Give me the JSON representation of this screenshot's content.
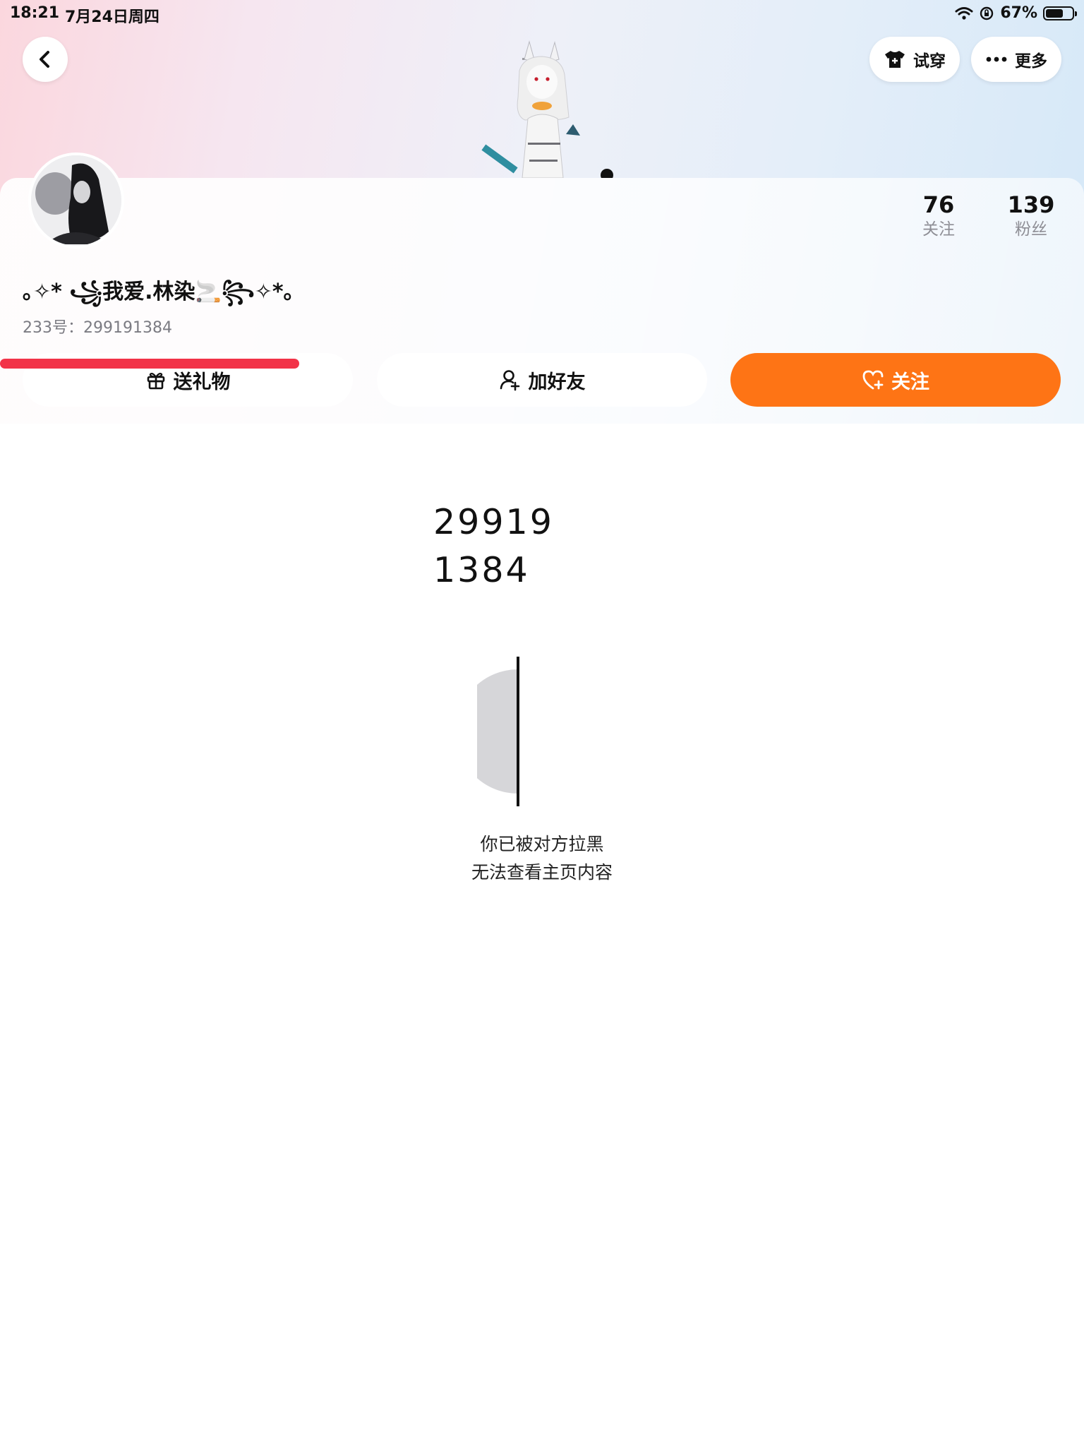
{
  "status_bar": {
    "time": "18:21",
    "date": "7月24日周四",
    "battery": "67%",
    "battery_level": 0.67
  },
  "header": {
    "tryon_label": "试穿",
    "more_label": "更多"
  },
  "profile": {
    "nickname": "｡✧* ꧁我爱.林染🚬꧂✧*｡",
    "id_line": "233号：299191384",
    "stats": [
      {
        "value": "76",
        "label": "关注"
      },
      {
        "value": "139",
        "label": "粉丝"
      }
    ]
  },
  "actions": {
    "gift_label": "送礼物",
    "add_friend_label": "加好友",
    "follow_label": "关注"
  },
  "overlay_id": {
    "line1": "29919",
    "line2": "1384"
  },
  "blocked": {
    "line1": "你已被对方拉黑",
    "line2": "无法查看主页内容"
  },
  "colors": {
    "follow_orange": "#fe7415",
    "red_bar": "#f23348"
  }
}
